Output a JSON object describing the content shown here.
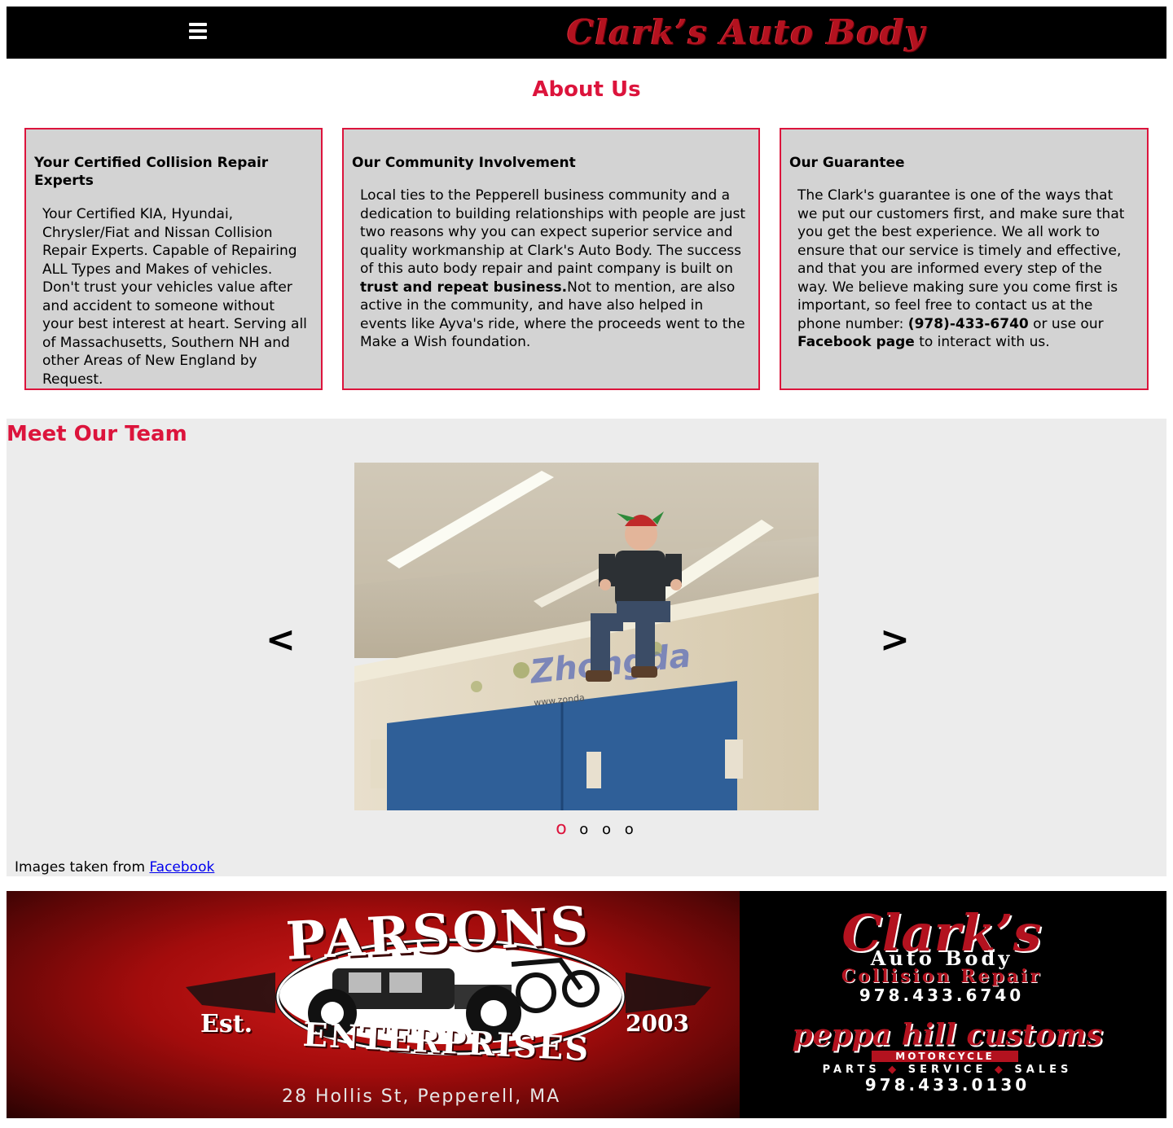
{
  "header": {
    "menu_icon": "hamburger-menu-icon",
    "site_title": "Clark’s Auto Body",
    "title_color": "#b3121f"
  },
  "about": {
    "heading": "About Us",
    "accent_color": "#dc143c",
    "cards": [
      {
        "title": "Your Certified Collision Repair Experts",
        "body": "Your Certified KIA, Hyundai, Chrysler/Fiat and Nissan Collision Repair Experts. Capable of Repairing ALL Types and Makes of vehicles. Don't trust your vehicles value after and accident to someone without your best interest at heart. Serving all of Massachusetts, Southern NH and other Areas of New England by Request."
      },
      {
        "title": "Our Community Involvement",
        "body_1": "Local ties to the Pepperell business community and a dedication to building relationships with people are just two reasons why you can expect superior service and quality workmanship at Clark's Auto Body. The success of this auto body repair and paint company is built on ",
        "body_bold": "trust and repeat business.",
        "body_2": "Not to mention, are also active in the community, and have also helped in events like Ayva's ride, where the proceeds went to the Make a Wish foundation."
      },
      {
        "title": "Our Guarantee",
        "body_1": "The Clark's guarantee is one of the ways that we put our customers first, and make sure that you get the best experience. We all work to ensure that our service is timely and effective, and that you are informed every step of the way. We believe making sure you come first is important, so feel free to contact us at the phone number: ",
        "phone": "(978)-433-6740",
        "body_2": " or use our ",
        "facebook": "Facebook page",
        "body_3": " to interact with us."
      }
    ]
  },
  "team": {
    "heading": "Meet Our Team",
    "prev_label": "<",
    "next_label": ">",
    "slide_sign_text": "Zhongda",
    "slide_sign_url": "www.zonda",
    "dots": [
      "o",
      "o",
      "o",
      "o"
    ],
    "active_dot": 0,
    "credit_prefix": "Images taken from ",
    "credit_link": "Facebook"
  },
  "banner": {
    "parsons_title": "PARSONS",
    "parsons_sub": "ENTERPRISES",
    "est": "Est.",
    "year": "2003",
    "address": "28 Hollis St, Pepperell, MA",
    "clarks_logo": "Clark’s",
    "clarks_line1": "Auto Body",
    "clarks_line2": "Collision Repair",
    "clarks_phone": "978.433.6740",
    "peppa": "peppa hill customs",
    "motorcycle": "MOTORCYCLE",
    "parts": "PARTS",
    "service": "SERVICE",
    "sales": "SALES",
    "peppa_phone": "978.433.0130"
  }
}
